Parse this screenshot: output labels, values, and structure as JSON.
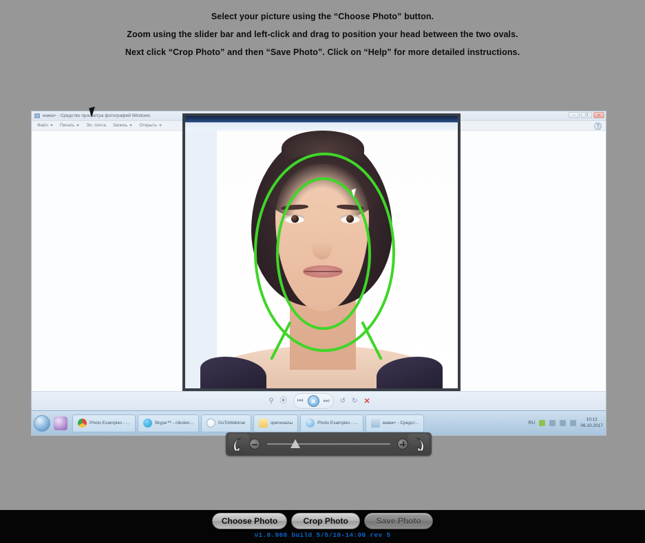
{
  "instructions": {
    "line1": "Select your picture using the “Choose Photo” button.",
    "line2": "Zoom using the slider bar and left-click and drag to position your head between the two ovals.",
    "line3": "Next click “Crop Photo” and then “Save Photo”.  Click on “Help” for more detailed instructions."
  },
  "colors": {
    "page_background": "#979797",
    "guide_green": "#3fd628",
    "version_blue": "#0b63c8",
    "action_bar": "#050505",
    "slider_bar": "#484848"
  },
  "backdrop": {
    "window_title": "мама+ - Средство просмотра фотографий Windows",
    "window_controls": [
      {
        "name": "minimize",
        "glyph": "–"
      },
      {
        "name": "maximize",
        "glyph": "❐"
      },
      {
        "name": "close",
        "glyph": "✕"
      }
    ],
    "menus": [
      {
        "label": "Файл",
        "caret": true
      },
      {
        "label": "Печать",
        "caret": true
      },
      {
        "label": "Эл. почта",
        "caret": false
      },
      {
        "label": "Запись",
        "caret": true
      },
      {
        "label": "Открыть",
        "caret": true
      }
    ],
    "help_glyph": "?",
    "toolbar": {
      "zoom_glyph": "⚲",
      "fit_glyph": "⦿",
      "prev_glyph": "⏮",
      "play_glyph": "▣",
      "next_glyph": "⏭",
      "rotate_left_glyph": "↺",
      "rotate_right_glyph": "↻",
      "delete_glyph": "✕"
    },
    "taskbar": {
      "buttons": [
        {
          "label": "Photo Examples - ...",
          "icon": "chrome"
        },
        {
          "label": "Skype™ - nikolen...",
          "icon": "skype"
        },
        {
          "label": "GoToWebinar",
          "icon": "gotow"
        },
        {
          "label": "оригиналы",
          "icon": "folder"
        },
        {
          "label": "Photo Examples - ...",
          "icon": "ie"
        },
        {
          "label": "мама+ - Средст...",
          "icon": "viewerico"
        }
      ],
      "language": "RU",
      "time": "10:12",
      "date": "06.10.2017"
    }
  },
  "slider": {
    "rotate_left_label": "Rotate left",
    "zoom_out_label": "Zoom out",
    "zoom_in_label": "Zoom in",
    "rotate_right_label": "Rotate right",
    "value_percent": 23
  },
  "actions": {
    "choose_photo": "Choose Photo",
    "crop_photo": "Crop Photo",
    "save_photo": "Save Photo",
    "save_photo_disabled": true
  },
  "version": "v1.0.960 build 5/5/10-14:00 rev 5"
}
